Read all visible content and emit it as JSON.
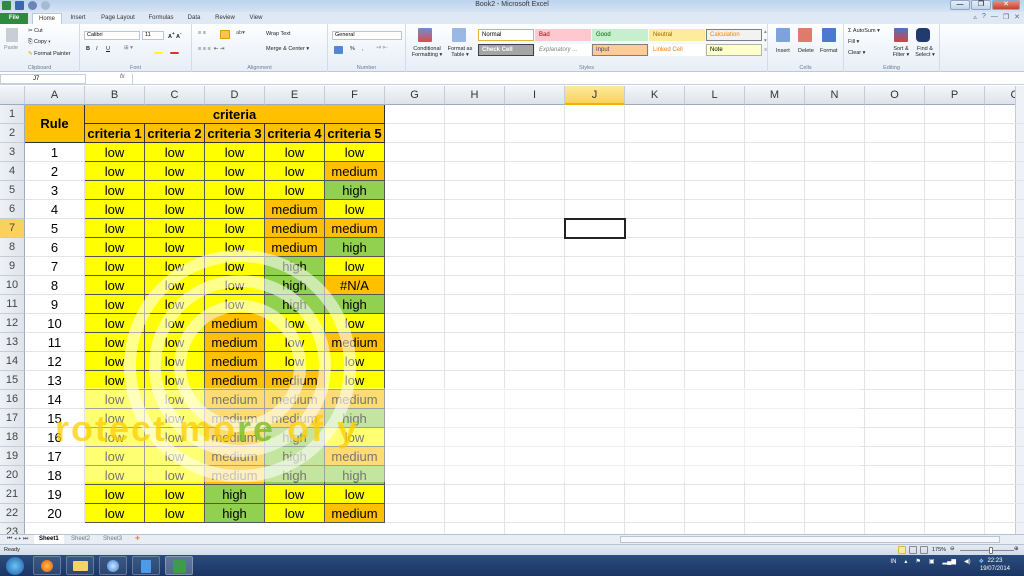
{
  "window": {
    "title": "Book2 - Microsoft Excel",
    "minimize": "—",
    "restore": "❐",
    "close": "✕"
  },
  "tabs": [
    "File",
    "Home",
    "Insert",
    "Page Layout",
    "Formulas",
    "Data",
    "Review",
    "View"
  ],
  "ribbon": {
    "clipboard": {
      "label": "Clipboard",
      "paste": "Paste",
      "cut": "Cut",
      "copy": "Copy ▾",
      "format_painter": "Format Painter"
    },
    "font": {
      "label": "Font",
      "family": "Calibri",
      "size": "11",
      "bold": "B",
      "italic": "I",
      "underline": "U"
    },
    "alignment": {
      "label": "Alignment",
      "wrap_text": "Wrap Text",
      "merge_center": "Merge & Center ▾"
    },
    "number": {
      "label": "Number",
      "format": "General",
      "percent": "%",
      "comma": ","
    },
    "styles": {
      "label": "Styles",
      "conditional_formatting": "Conditional Formatting ▾",
      "format_as_table": "Format as Table ▾",
      "items": [
        {
          "name": "Normal",
          "bg": "#ffffff",
          "fg": "#000000",
          "border": "#e3b33c"
        },
        {
          "name": "Bad",
          "bg": "#ffc7ce",
          "fg": "#9c0006",
          "border": "#ffc7ce"
        },
        {
          "name": "Good",
          "bg": "#c6efce",
          "fg": "#006100",
          "border": "#c6efce"
        },
        {
          "name": "Neutral",
          "bg": "#ffeb9c",
          "fg": "#9c6500",
          "border": "#ffeb9c"
        },
        {
          "name": "Calculation",
          "bg": "#f2f2f2",
          "fg": "#fa7d00",
          "border": "#7f7f7f"
        },
        {
          "name": "Check Cell",
          "bg": "#a5a5a5",
          "fg": "#ffffff",
          "border": "#3f3f3f"
        },
        {
          "name": "Explanatory ...",
          "bg": "#ffffff",
          "fg": "#7f7f7f",
          "border": "#ffffff"
        },
        {
          "name": "Input",
          "bg": "#ffcc99",
          "fg": "#3f3f76",
          "border": "#7f7f7f"
        },
        {
          "name": "Linked Cell",
          "bg": "#ffffff",
          "fg": "#fa7d00",
          "border": "#ffffff"
        },
        {
          "name": "Note",
          "bg": "#ffffcc",
          "fg": "#000000",
          "border": "#b2b2b2"
        }
      ]
    },
    "cells": {
      "label": "Cells",
      "insert": "Insert",
      "delete": "Delete",
      "format": "Format"
    },
    "editing": {
      "label": "Editing",
      "autosum": "Σ AutoSum ▾",
      "fill": "Fill ▾",
      "clear": "Clear ▾",
      "sort_filter": "Sort & Filter ▾",
      "find_select": "Find & Select ▾"
    }
  },
  "formula_bar": {
    "name_box": "J7",
    "fx": "fx",
    "value": ""
  },
  "columns": [
    "A",
    "B",
    "C",
    "D",
    "E",
    "F",
    "G",
    "H",
    "I",
    "J",
    "K",
    "L",
    "M",
    "N",
    "O",
    "P",
    "C"
  ],
  "rows": [
    "1",
    "2",
    "3",
    "4",
    "5",
    "6",
    "7",
    "8",
    "9",
    "10",
    "11",
    "12",
    "13",
    "14",
    "15",
    "16",
    "17",
    "18",
    "19",
    "20",
    "21",
    "22",
    "23"
  ],
  "selected_cell": "J7",
  "table": {
    "rule_header": "Rule",
    "criteria_header": "criteria",
    "criteria_cols": [
      "criteria 1",
      "criteria 2",
      "criteria 3",
      "criteria 4",
      "criteria 5"
    ],
    "colors": {
      "low": "#ffff00",
      "medium": "#ffc000",
      "high": "#92d050",
      "#N/A": "#ffc000",
      "header": "#ffc000"
    },
    "rows": [
      {
        "rule": "1",
        "values": [
          "low",
          "low",
          "low",
          "low",
          "low"
        ]
      },
      {
        "rule": "2",
        "values": [
          "low",
          "low",
          "low",
          "low",
          "medium"
        ]
      },
      {
        "rule": "3",
        "values": [
          "low",
          "low",
          "low",
          "low",
          "high"
        ]
      },
      {
        "rule": "4",
        "values": [
          "low",
          "low",
          "low",
          "medium",
          "low"
        ]
      },
      {
        "rule": "5",
        "values": [
          "low",
          "low",
          "low",
          "medium",
          "medium"
        ]
      },
      {
        "rule": "6",
        "values": [
          "low",
          "low",
          "low",
          "medium",
          "high"
        ]
      },
      {
        "rule": "7",
        "values": [
          "low",
          "low",
          "low",
          "high",
          "low"
        ]
      },
      {
        "rule": "8",
        "values": [
          "low",
          "low",
          "low",
          "high",
          "#N/A"
        ]
      },
      {
        "rule": "9",
        "values": [
          "low",
          "low",
          "low",
          "high",
          "high"
        ]
      },
      {
        "rule": "10",
        "values": [
          "low",
          "low",
          "medium",
          "low",
          "low"
        ]
      },
      {
        "rule": "11",
        "values": [
          "low",
          "low",
          "medium",
          "low",
          "medium"
        ]
      },
      {
        "rule": "12",
        "values": [
          "low",
          "low",
          "medium",
          "low",
          "low"
        ]
      },
      {
        "rule": "13",
        "values": [
          "low",
          "low",
          "medium",
          "medium",
          "low"
        ]
      },
      {
        "rule": "14",
        "values": [
          "low",
          "low",
          "medium",
          "medium",
          "medium"
        ]
      },
      {
        "rule": "15",
        "values": [
          "low",
          "low",
          "medium",
          "medium",
          "high"
        ]
      },
      {
        "rule": "16",
        "values": [
          "low",
          "low",
          "medium",
          "high",
          "low"
        ]
      },
      {
        "rule": "17",
        "values": [
          "low",
          "low",
          "medium",
          "high",
          "medium"
        ]
      },
      {
        "rule": "18",
        "values": [
          "low",
          "low",
          "medium",
          "high",
          "high"
        ]
      },
      {
        "rule": "19",
        "values": [
          "low",
          "low",
          "high",
          "low",
          "low"
        ]
      },
      {
        "rule": "20",
        "values": [
          "low",
          "low",
          "high",
          "low",
          "medium"
        ]
      }
    ]
  },
  "watermark": {
    "text_a": "rotect mo",
    "text_b": "re",
    "text_c": " of y"
  },
  "sheets": [
    "Sheet1",
    "Sheet2",
    "Sheet3"
  ],
  "active_sheet": "Sheet1",
  "status": {
    "ready": "Ready",
    "zoom": "175%"
  },
  "taskbar": {
    "apps": [
      "start",
      "firefox",
      "explorer",
      "itunes",
      "notepad",
      "excel"
    ],
    "lang": "IN",
    "time": "22:23",
    "date": "19/07/2014"
  }
}
